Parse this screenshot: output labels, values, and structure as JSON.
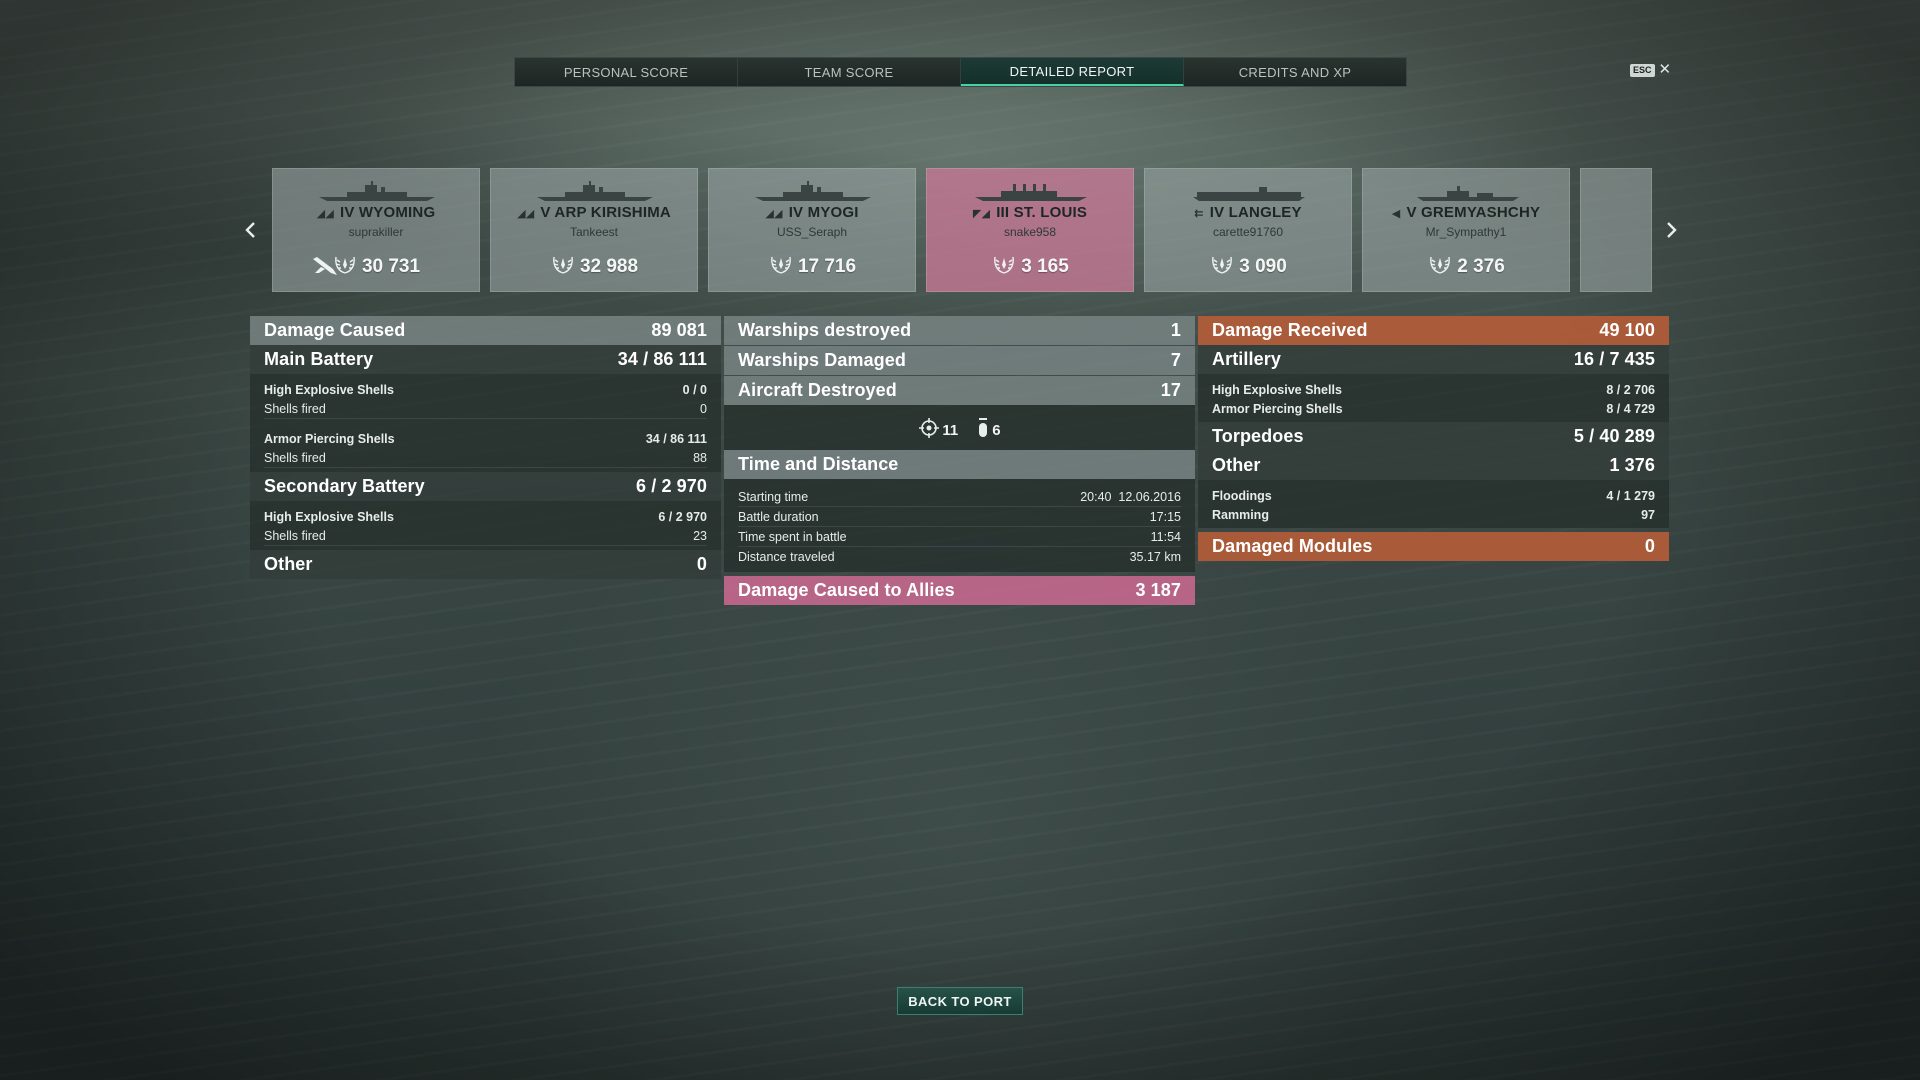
{
  "tabs": [
    {
      "label": "PERSONAL SCORE"
    },
    {
      "label": "TEAM SCORE"
    },
    {
      "label": "DETAILED REPORT",
      "active": true
    },
    {
      "label": "CREDITS AND XP"
    }
  ],
  "esc": {
    "key": "ESC",
    "close": "✕"
  },
  "ships": [
    {
      "name": "IV WYOMING",
      "player": "suprakiller",
      "score": "30 731",
      "class": "battleship",
      "plane_icon": true
    },
    {
      "name": "V ARP KIRISHIMA",
      "player": "Tankeest",
      "score": "32 988",
      "class": "battleship"
    },
    {
      "name": "IV MYOGI",
      "player": "USS_Seraph",
      "score": "17 716",
      "class": "battleship"
    },
    {
      "name": "III ST. LOUIS",
      "player": "snake958",
      "score": "3 165",
      "class": "cruiser",
      "selected": true
    },
    {
      "name": "IV LANGLEY",
      "player": "carette91760",
      "score": "3 090",
      "class": "carrier"
    },
    {
      "name": "V GREMYASHCHY",
      "player": "Mr_Sympathy1",
      "score": "2 376",
      "class": "destroyer"
    },
    {
      "name": "",
      "player": "",
      "score": "",
      "class": "partial"
    }
  ],
  "left": {
    "damage_caused": {
      "label": "Damage Caused",
      "value": "89 081"
    },
    "main_battery": {
      "label": "Main Battery",
      "value": "34 / 86 111"
    },
    "mb_he": {
      "label": "High Explosive Shells",
      "value": "0 / 0"
    },
    "mb_he_fired": {
      "label": "Shells fired",
      "value": "0"
    },
    "mb_ap": {
      "label": "Armor Piercing Shells",
      "value": "34 / 86 111"
    },
    "mb_ap_fired": {
      "label": "Shells fired",
      "value": "88"
    },
    "secondary": {
      "label": "Secondary Battery",
      "value": "6 / 2 970"
    },
    "sb_he": {
      "label": "High Explosive Shells",
      "value": "6 / 2 970"
    },
    "sb_he_fired": {
      "label": "Shells fired",
      "value": "23"
    },
    "other": {
      "label": "Other",
      "value": "0"
    }
  },
  "middle": {
    "warships_destroyed": {
      "label": "Warships destroyed",
      "value": "1"
    },
    "warships_damaged": {
      "label": "Warships Damaged",
      "value": "7"
    },
    "aircraft_destroyed": {
      "label": "Aircraft Destroyed",
      "value": "17"
    },
    "aircraft_fighters": "11",
    "aircraft_bombers": "6",
    "time_distance": {
      "label": "Time and Distance"
    },
    "starting_time": {
      "label": "Starting time",
      "value": "20:40  12.06.2016"
    },
    "battle_duration": {
      "label": "Battle duration",
      "value": "17:15"
    },
    "time_in_battle": {
      "label": "Time spent in battle",
      "value": "11:54"
    },
    "distance": {
      "label": "Distance traveled",
      "value": "35.17 km"
    },
    "damage_allies": {
      "label": "Damage Caused to Allies",
      "value": "3 187"
    }
  },
  "right": {
    "damage_received": {
      "label": "Damage Received",
      "value": "49 100"
    },
    "artillery": {
      "label": "Artillery",
      "value": "16 / 7 435"
    },
    "art_he": {
      "label": "High Explosive Shells",
      "value": "8 / 2 706"
    },
    "art_ap": {
      "label": "Armor Piercing Shells",
      "value": "8 / 4 729"
    },
    "torpedoes": {
      "label": "Torpedoes",
      "value": "5 / 40 289"
    },
    "other": {
      "label": "Other",
      "value": "1 376"
    },
    "floodings": {
      "label": "Floodings",
      "value": "4 / 1 279"
    },
    "ramming": {
      "label": "Ramming",
      "value": "97"
    },
    "damaged_modules": {
      "label": "Damaged Modules",
      "value": "0"
    }
  },
  "back_button": "BACK TO PORT",
  "colors": {
    "accent": "#4ad0a8",
    "damage_received": "#b25c38",
    "selected_ship": "#c8789a",
    "allies": "#c86991"
  }
}
